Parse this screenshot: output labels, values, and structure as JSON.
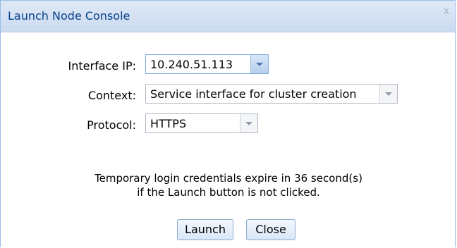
{
  "dialog": {
    "title": "Launch Node Console",
    "close_glyph": "x"
  },
  "form": {
    "interface_ip": {
      "label": "Interface IP:",
      "value": "10.240.51.113"
    },
    "context": {
      "label": "Context:",
      "value": "Service interface for cluster creation"
    },
    "protocol": {
      "label": "Protocol:",
      "value": "HTTPS"
    }
  },
  "message": {
    "line1": "Temporary login credentials expire in 36 second(s)",
    "line2": "if the Launch button is not clicked."
  },
  "buttons": {
    "launch": "Launch",
    "close": "Close"
  },
  "icons": {
    "dropdown": "chevron-down-icon",
    "close": "close-icon"
  },
  "colors": {
    "title_text": "#04408c",
    "border": "#99bce8",
    "titlebar": "#cbdaf0"
  }
}
